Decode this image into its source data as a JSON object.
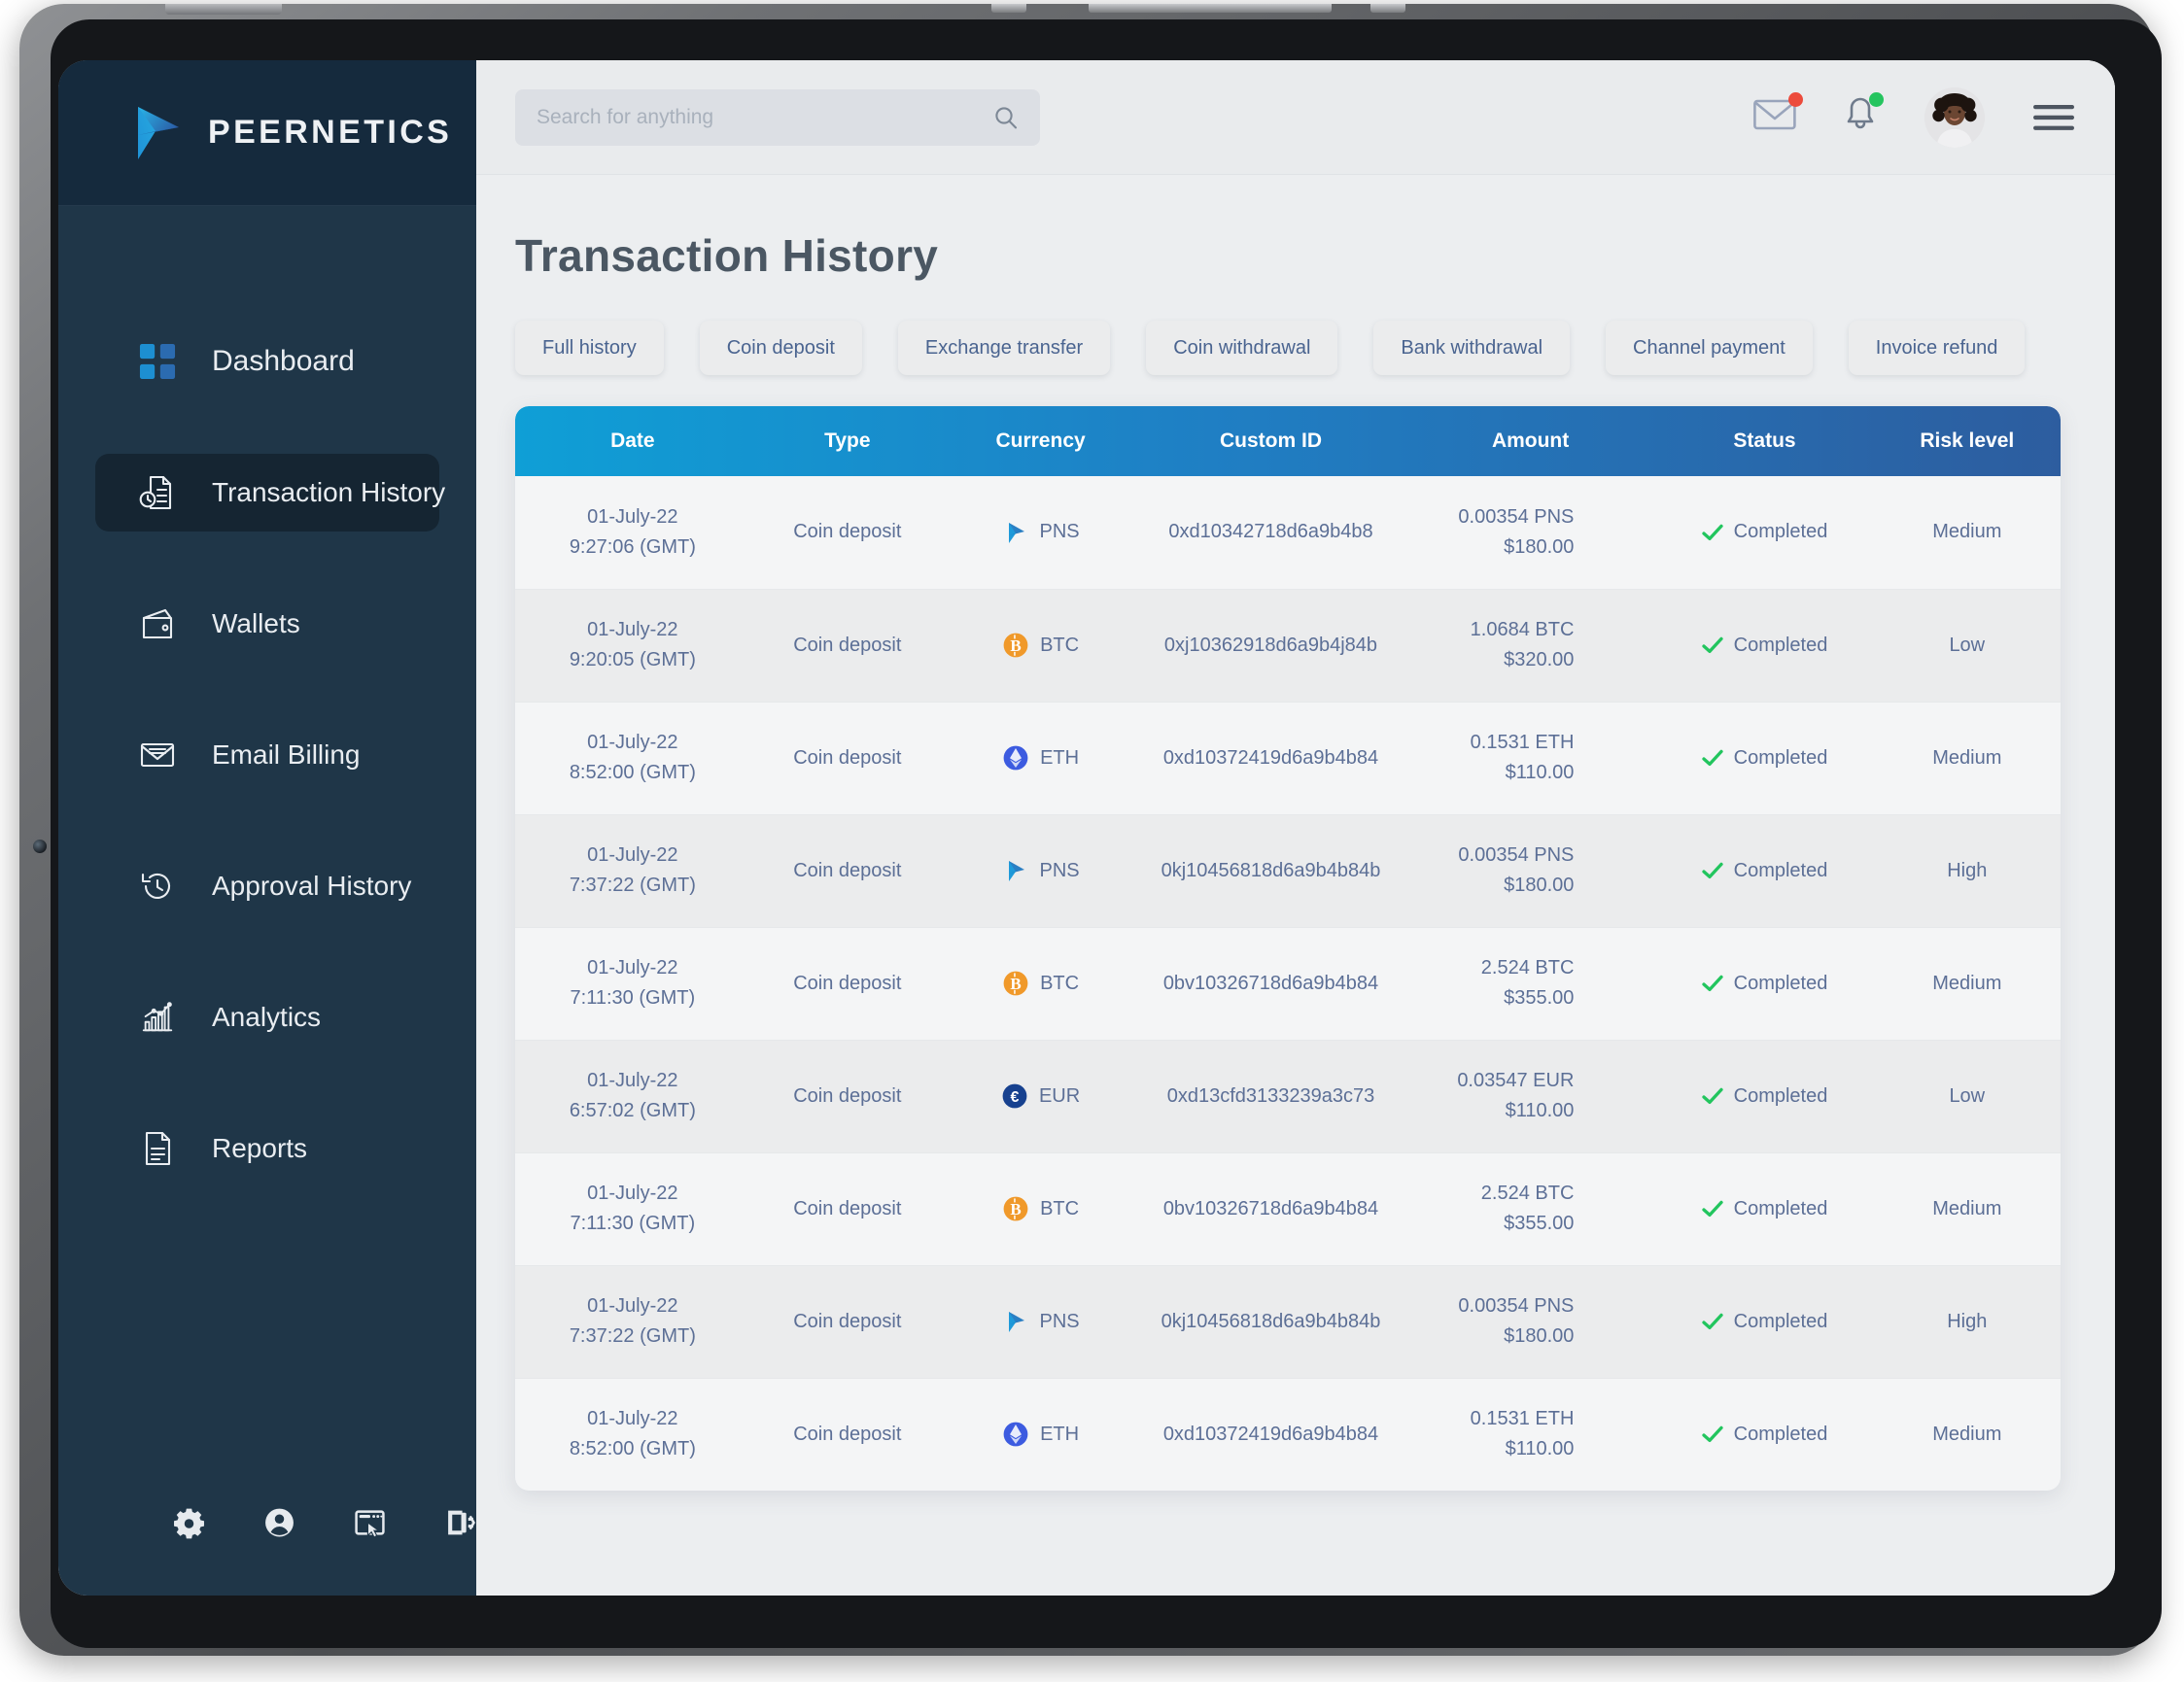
{
  "brand": {
    "name": "PEERNETICS",
    "logo_icon": "play-triangle-logo",
    "accent": "#1b9ad6"
  },
  "sidebar": {
    "items": [
      {
        "label": "Dashboard",
        "icon": "grid-squares-icon",
        "active": false
      },
      {
        "label": "Transaction History",
        "icon": "document-clock-icon",
        "active": true
      },
      {
        "label": "Wallets",
        "icon": "wallet-icon",
        "active": false
      },
      {
        "label": "Email Billing",
        "icon": "envelope-icon",
        "active": false
      },
      {
        "label": "Approval History",
        "icon": "clock-rewind-icon",
        "active": false
      },
      {
        "label": "Analytics",
        "icon": "bar-chart-icon",
        "active": false
      },
      {
        "label": "Reports",
        "icon": "file-lines-icon",
        "active": false
      }
    ],
    "footer_icons": [
      "gear-icon",
      "user-circle-icon",
      "browser-cursor-icon",
      "logout-icon"
    ]
  },
  "topbar": {
    "search": {
      "value": "",
      "placeholder": "Search for anything",
      "icon": "search-icon"
    },
    "mail": {
      "icon": "mail-icon",
      "badge_color": "#ec4b3c"
    },
    "notifications": {
      "icon": "bell-icon",
      "badge_color": "#25c45f"
    },
    "avatar": {
      "icon": "avatar",
      "alt": "user-profile-photo"
    },
    "menu": {
      "icon": "hamburger-menu-icon"
    }
  },
  "page": {
    "title": "Transaction History",
    "tabs": [
      {
        "label": "Full history"
      },
      {
        "label": "Coin deposit"
      },
      {
        "label": "Exchange transfer"
      },
      {
        "label": "Coin withdrawal"
      },
      {
        "label": "Bank withdrawal"
      },
      {
        "label": "Channel payment"
      },
      {
        "label": "Invoice refund"
      }
    ]
  },
  "table": {
    "columns": [
      "Date",
      "Type",
      "Currency",
      "Custom ID",
      "Amount",
      "Status",
      "Risk level"
    ],
    "header_gradient_from": "#0f9fd6",
    "header_gradient_to": "#2d5d9f",
    "status_check_color": "#22c55e",
    "rows": [
      {
        "date": "01-July-22",
        "time": "9:27:06 (GMT)",
        "type": "Coin deposit",
        "currency": "PNS",
        "currency_icon": "pns-coin-icon",
        "custom_id": "0xd10342718d6a9b4b8",
        "amount_crypto": "0.00354 PNS",
        "amount_fiat": "$180.00",
        "status": "Completed",
        "risk": "Medium"
      },
      {
        "date": "01-July-22",
        "time": "9:20:05 (GMT)",
        "type": "Coin deposit",
        "currency": "BTC",
        "currency_icon": "btc-coin-icon",
        "custom_id": "0xj10362918d6a9b4j84b",
        "amount_crypto": "1.0684 BTC",
        "amount_fiat": "$320.00",
        "status": "Completed",
        "risk": "Low"
      },
      {
        "date": "01-July-22",
        "time": "8:52:00 (GMT)",
        "type": "Coin deposit",
        "currency": "ETH",
        "currency_icon": "eth-coin-icon",
        "custom_id": "0xd10372419d6a9b4b84",
        "amount_crypto": "0.1531 ETH",
        "amount_fiat": "$110.00",
        "status": "Completed",
        "risk": "Medium"
      },
      {
        "date": "01-July-22",
        "time": "7:37:22 (GMT)",
        "type": "Coin deposit",
        "currency": "PNS",
        "currency_icon": "pns-coin-icon",
        "custom_id": "0kj10456818d6a9b4b84b",
        "amount_crypto": "0.00354 PNS",
        "amount_fiat": "$180.00",
        "status": "Completed",
        "risk": "High"
      },
      {
        "date": "01-July-22",
        "time": "7:11:30 (GMT)",
        "type": "Coin deposit",
        "currency": "BTC",
        "currency_icon": "btc-coin-icon",
        "custom_id": "0bv10326718d6a9b4b84",
        "amount_crypto": "2.524 BTC",
        "amount_fiat": "$355.00",
        "status": "Completed",
        "risk": "Medium"
      },
      {
        "date": "01-July-22",
        "time": "6:57:02 (GMT)",
        "type": "Coin deposit",
        "currency": "EUR",
        "currency_icon": "eur-coin-icon",
        "custom_id": "0xd13cfd3133239a3c73",
        "amount_crypto": "0.03547 EUR",
        "amount_fiat": "$110.00",
        "status": "Completed",
        "risk": "Low"
      },
      {
        "date": "01-July-22",
        "time": "7:11:30 (GMT)",
        "type": "Coin deposit",
        "currency": "BTC",
        "currency_icon": "btc-coin-icon",
        "custom_id": "0bv10326718d6a9b4b84",
        "amount_crypto": "2.524 BTC",
        "amount_fiat": "$355.00",
        "status": "Completed",
        "risk": "Medium"
      },
      {
        "date": "01-July-22",
        "time": "7:37:22 (GMT)",
        "type": "Coin deposit",
        "currency": "PNS",
        "currency_icon": "pns-coin-icon",
        "custom_id": "0kj10456818d6a9b4b84b",
        "amount_crypto": "0.00354 PNS",
        "amount_fiat": "$180.00",
        "status": "Completed",
        "risk": "High"
      },
      {
        "date": "01-July-22",
        "time": "8:52:00 (GMT)",
        "type": "Coin deposit",
        "currency": "ETH",
        "currency_icon": "eth-coin-icon",
        "custom_id": "0xd10372419d6a9b4b84",
        "amount_crypto": "0.1531 ETH",
        "amount_fiat": "$110.00",
        "status": "Completed",
        "risk": "Medium"
      }
    ]
  }
}
